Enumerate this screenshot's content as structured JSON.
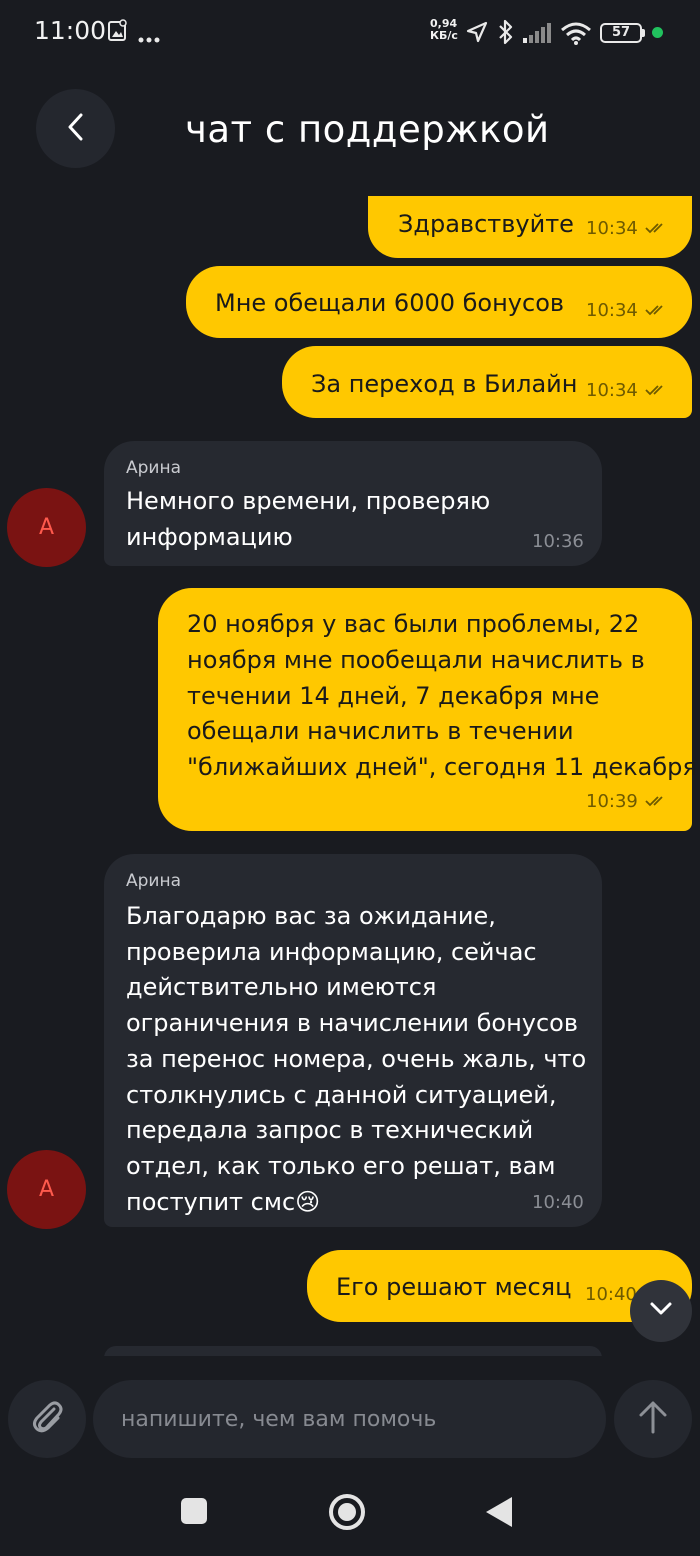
{
  "status_bar": {
    "time": "11:00",
    "net_speed_value": "0,94",
    "net_speed_unit": "КБ/с",
    "battery": "57",
    "icons": [
      "image-icon",
      "more-dots-icon",
      "location-arrow-icon",
      "bluetooth-icon",
      "signal-icon",
      "wifi-icon",
      "battery-icon"
    ]
  },
  "header": {
    "title": "чат с поддержкой",
    "back_icon": "chevron-left-icon"
  },
  "messages": [
    {
      "from": "user",
      "text": "Здравствуйте",
      "time": "10:34",
      "read": true
    },
    {
      "from": "user",
      "text": "Мне обещали 6000 бонусов",
      "time": "10:34",
      "read": true
    },
    {
      "from": "user",
      "text": "За переход в Билайн",
      "time": "10:34",
      "read": true
    },
    {
      "from": "agent",
      "sender": "Арина",
      "avatar_letter": "А",
      "lines": [
        "Немного времени, проверяю",
        "информацию"
      ],
      "time": "10:36"
    },
    {
      "from": "user",
      "lines": [
        "20 ноября у вас были проблемы, 22",
        "ноября мне пообещали начислить в",
        "течении 14 дней, 7 декабря мне",
        "обещали начислить в течении",
        "\"ближайших дней\", сегодня 11 декабря"
      ],
      "time": "10:39",
      "read": true
    },
    {
      "from": "agent",
      "sender": "Арина",
      "avatar_letter": "А",
      "lines": [
        "Благодарю вас за ожидание,",
        "проверила информацию, сейчас",
        "действительно имеются",
        "ограничения в начислении бонусов",
        "за перенос номера, очень жаль, что",
        "столкнулись с данной ситуацией,",
        "передала запрос в технический",
        "отдел, как только его решат, вам",
        "поступит смс😢"
      ],
      "time": "10:40"
    },
    {
      "from": "user",
      "text": "Его решают месяц",
      "time": "10:40",
      "read": true
    }
  ],
  "composer": {
    "placeholder": "напишите, чем вам помочь",
    "attach_icon": "paperclip-icon",
    "send_icon": "arrow-up-icon"
  },
  "colors": {
    "background": "#191b20",
    "user_bubble": "#ffc800",
    "agent_bubble": "#262930",
    "avatar": "#7a1312"
  }
}
